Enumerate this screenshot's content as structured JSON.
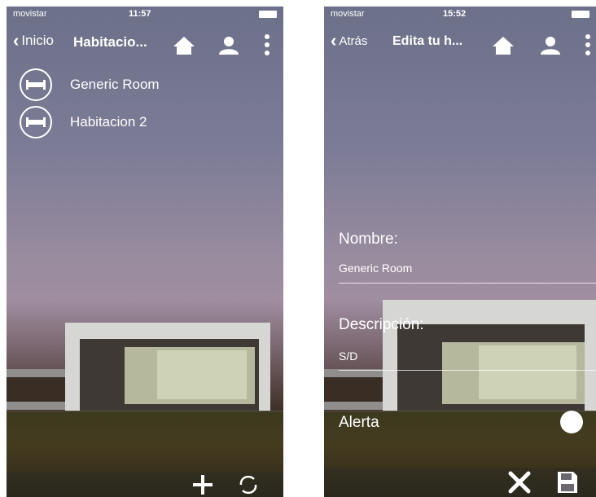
{
  "left_screen": {
    "status": {
      "carrier": "movistar",
      "time": "11:57"
    },
    "nav": {
      "back_label": "Inicio",
      "title": "Habitacio..."
    },
    "rooms": [
      {
        "name": "Generic Room",
        "icon": "bed-icon"
      },
      {
        "name": "Habitacion 2",
        "icon": "bed-icon"
      }
    ],
    "toolbar": {
      "icons": [
        "plus-icon",
        "refresh-icon"
      ]
    }
  },
  "right_screen": {
    "status": {
      "carrier": "movistar",
      "time": "15:52"
    },
    "nav": {
      "back_label": "Atrás",
      "title": "Edita tu h..."
    },
    "form": {
      "name_label": "Nombre:",
      "name_value": "Generic Room",
      "desc_label": "Descripción:",
      "desc_value": "S/D",
      "alert_label": "Alerta"
    },
    "toolbar": {
      "icons": [
        "close-icon",
        "save-icon"
      ]
    }
  },
  "colors": {
    "text": "#ffffff",
    "sky_top": "#6c7089",
    "sky_mid": "#9a8c9f",
    "ground": "#3b3a1e"
  }
}
